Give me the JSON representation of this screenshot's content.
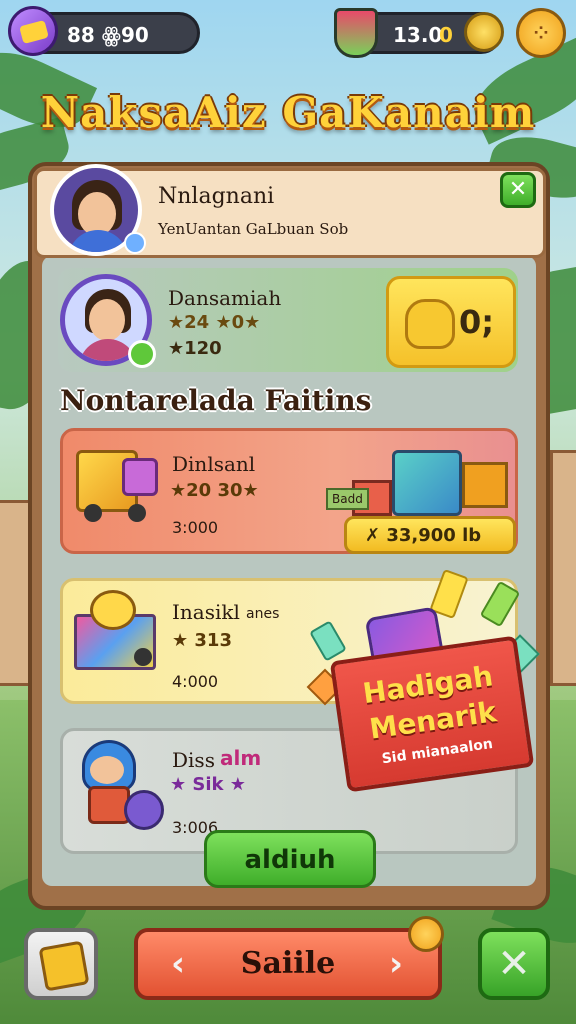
{
  "top_bar": {
    "left_currency": "88 ꙮ90",
    "right_currency": "13.0",
    "right_currency_suffix": "0"
  },
  "title": "NaksaAiz GaKanaim",
  "header": {
    "name": "Nnlagnani",
    "subtitle": "YenUantan GaLbuan Sob"
  },
  "profile": {
    "name": "Dansamiah",
    "rating": "★24 ★0★",
    "stars": "★120",
    "coin_label": "0;"
  },
  "section_title": "Nontarelada Faitins",
  "items": [
    {
      "name": "Dinlsanl",
      "rating": "★20 30★",
      "price": "3:000"
    },
    {
      "name": "Inasikl",
      "name_suffix": "anes",
      "rating": "★ 313",
      "price": "4:000"
    },
    {
      "name": "Diss",
      "name_suffix": "alm",
      "rating": "★ Sik ★",
      "price": "3:006"
    }
  ],
  "featured_price": "✗ 33,900 lb",
  "featured_tag": "Badd",
  "banner": {
    "line1": "Hadigah",
    "line2": "Menarik",
    "line3": "Sid mianaalon"
  },
  "action_button": "aldiuh",
  "bottom_button": "Saiile",
  "colors": {
    "panel_wood": "#a07048",
    "accent_gold": "#f5c12a",
    "accent_green": "#3fae2a",
    "accent_red": "#e25232"
  }
}
